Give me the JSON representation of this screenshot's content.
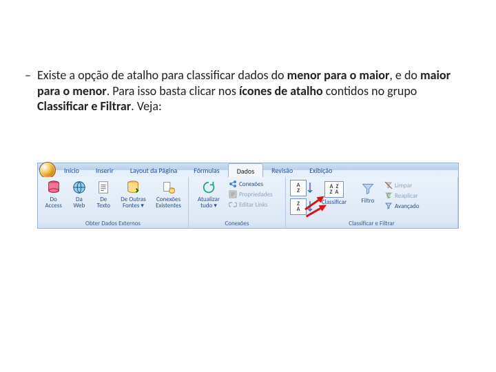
{
  "bullet": {
    "pre": "Existe a opção de atalho para classificar dados do ",
    "b1": "menor para o maior",
    "mid1": ", e do ",
    "b2": "maior para o menor",
    "mid2": ". Para isso basta clicar nos ",
    "b3": "ícones de atalho",
    "mid3": " contidos no grupo ",
    "b4": "Classificar e Filtrar",
    "end": ". Veja:"
  },
  "ribbon": {
    "tabs": [
      "Início",
      "Inserir",
      "Layout da Página",
      "Fórmulas",
      "Dados",
      "Revisão",
      "Exibição"
    ],
    "active_tab_index": 4,
    "groups": {
      "obter": {
        "label": "Obter Dados Externos",
        "btns": {
          "access": "Do\nAccess",
          "web": "Da\nWeb",
          "texto": "De\nTexto",
          "outras": "De Outras\nFontes ▾",
          "exist": "Conexões\nExistentes"
        }
      },
      "conexoes": {
        "label": "Conexões",
        "atualizar": "Atualizar\ntudo ▾",
        "links": {
          "conexoes": "Conexões",
          "prop": "Propriedades",
          "editar": "Editar Links"
        }
      },
      "classificar": {
        "label": "Classificar e Filtrar",
        "sort_az_top": "A",
        "sort_az_bot": "Z",
        "sort_za_top": "Z",
        "sort_za_bot": "A",
        "classificar": "Classificar",
        "filtro": "Filtro",
        "limpar": "Limpar",
        "reaplicar": "Reaplicar",
        "avancado": "Avançado"
      }
    }
  }
}
